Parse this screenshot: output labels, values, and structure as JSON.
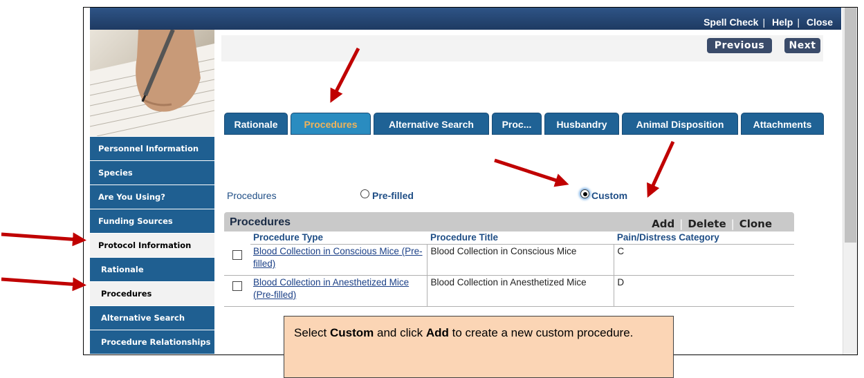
{
  "top_links": [
    "Spell Check",
    "Help",
    "Close"
  ],
  "nav_buttons": {
    "previous": "Previous",
    "next": "Next"
  },
  "sidebar": {
    "items": [
      {
        "label": "Personnel Information",
        "style": "blue"
      },
      {
        "label": "Species",
        "style": "blue"
      },
      {
        "label": "Are You Using?",
        "style": "blue"
      },
      {
        "label": "Funding Sources",
        "style": "blue"
      },
      {
        "label": "Protocol Information",
        "style": "white"
      },
      {
        "label": "Rationale",
        "style": "blue"
      },
      {
        "label": "Procedures",
        "style": "white"
      },
      {
        "label": "Alternative Search",
        "style": "blue"
      },
      {
        "label": "Procedure Relationships",
        "style": "blue"
      }
    ]
  },
  "tabs": [
    "Rationale",
    "Procedures",
    "Alternative Search",
    "Proc...",
    "Husbandry",
    "Animal Disposition",
    "Attachments"
  ],
  "active_tab": "Procedures",
  "procedure_mode": {
    "label": "Procedures",
    "options": [
      "Pre-filled",
      "Custom"
    ],
    "selected": "Custom"
  },
  "grid": {
    "title": "Procedures",
    "actions": [
      "Add",
      "Delete",
      "Clone"
    ],
    "columns": [
      "Procedure Type",
      "Procedure Title",
      "Pain/Distress Category"
    ],
    "rows": [
      {
        "type": "Blood Collection in Conscious Mice (Pre-filled)",
        "title": "Blood Collection in Conscious Mice",
        "category": "C"
      },
      {
        "type": "Blood Collection in Anesthetized Mice (Pre-filled)",
        "title": "Blood Collection in Anesthetized Mice",
        "category": "D"
      }
    ]
  },
  "callout": {
    "part1": "Select ",
    "bold1": "Custom",
    "part2": " and click ",
    "bold2": "Add",
    "part3": " to create a new custom procedure."
  },
  "colors": {
    "accent_blue": "#1f6295",
    "arrow_red": "#c00000",
    "callout_bg": "#fbd5b5",
    "active_tab_text": "#f0b35a"
  }
}
